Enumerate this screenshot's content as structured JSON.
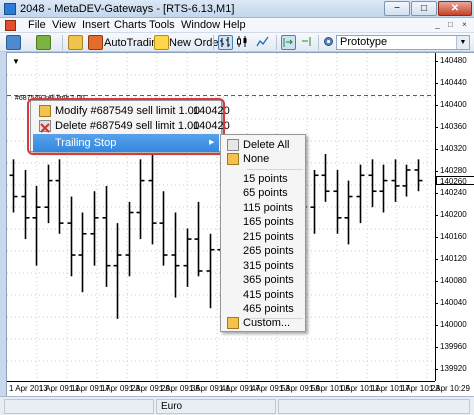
{
  "window": {
    "title": "2048 - MetaDEV-Gateways - [RTS-6.13,M1]",
    "min_glyph": "−",
    "max_glyph": "□",
    "close_glyph": "✕"
  },
  "menu": {
    "items": [
      "File",
      "View",
      "Insert",
      "Charts",
      "Tools",
      "Window",
      "Help"
    ],
    "mdi_min": "_",
    "mdi_restore": "□",
    "mdi_close": "×"
  },
  "toolbar": {
    "autotrading_label": "AutoTrading",
    "new_order_label": "New Order",
    "profile_value": "Prototype",
    "combo_arrow": "▼"
  },
  "chart": {
    "order_label": "#687549 sell limit 1.00",
    "scroll_marker": "▼",
    "current_price_label": "140260",
    "price_labels": [
      "140480",
      "140440",
      "140400",
      "140360",
      "140320",
      "140280",
      "140240",
      "140200",
      "140160",
      "140120",
      "140080",
      "140040",
      "140000",
      "139960",
      "139920"
    ],
    "time_labels": [
      "1 Apr 2013",
      "1 Apr 09:11",
      "1 Apr 09:17",
      "1 Apr 09:23",
      "1 Apr 09:29",
      "1 Apr 09:35",
      "1 Apr 09:41",
      "1 Apr 09:47",
      "1 Apr 09:53",
      "1 Apr 09:59",
      "1 Apr 10:05",
      "1 Apr 10:11",
      "1 Apr 10:17",
      "1 Apr 10:23",
      "1 Apr 10:29"
    ],
    "colors": {
      "grid": "#c8c8c8",
      "bars": "#000000",
      "order_line": "#00a000"
    }
  },
  "chart_data": {
    "type": "ohlc",
    "title": "",
    "xlabel": "",
    "ylabel": "",
    "ylim": [
      139900,
      140500
    ],
    "bars": [
      {
        "o": 140270,
        "h": 140300,
        "l": 140200,
        "c": 140230
      },
      {
        "o": 140230,
        "h": 140280,
        "l": 140150,
        "c": 140190
      },
      {
        "o": 140190,
        "h": 140250,
        "l": 140100,
        "c": 140210
      },
      {
        "o": 140210,
        "h": 140290,
        "l": 140180,
        "c": 140260
      },
      {
        "o": 140260,
        "h": 140300,
        "l": 140160,
        "c": 140180
      },
      {
        "o": 140180,
        "h": 140230,
        "l": 140080,
        "c": 140120
      },
      {
        "o": 140120,
        "h": 140200,
        "l": 140050,
        "c": 140160
      },
      {
        "o": 140160,
        "h": 140240,
        "l": 140100,
        "c": 140190
      },
      {
        "o": 140190,
        "h": 140250,
        "l": 140060,
        "c": 140100
      },
      {
        "o": 140100,
        "h": 140180,
        "l": 140000,
        "c": 140120
      },
      {
        "o": 140120,
        "h": 140220,
        "l": 140080,
        "c": 140200
      },
      {
        "o": 140200,
        "h": 140300,
        "l": 140150,
        "c": 140260
      },
      {
        "o": 140260,
        "h": 140310,
        "l": 140140,
        "c": 140180
      },
      {
        "o": 140180,
        "h": 140240,
        "l": 140100,
        "c": 140120
      },
      {
        "o": 140120,
        "h": 140200,
        "l": 140040,
        "c": 140100
      },
      {
        "o": 140100,
        "h": 140170,
        "l": 140060,
        "c": 140150
      },
      {
        "o": 140150,
        "h": 140220,
        "l": 140080,
        "c": 140090
      },
      {
        "o": 140090,
        "h": 140160,
        "l": 140020,
        "c": 140130
      },
      {
        "o": 140130,
        "h": 140200,
        "l": 140080,
        "c": 140110
      },
      {
        "o": 140110,
        "h": 140190,
        "l": 140070,
        "c": 140170
      },
      {
        "o": 140170,
        "h": 140240,
        "l": 140120,
        "c": 140200
      },
      {
        "o": 140200,
        "h": 140260,
        "l": 140120,
        "c": 140150
      },
      {
        "o": 140150,
        "h": 140220,
        "l": 140100,
        "c": 140180
      },
      {
        "o": 140180,
        "h": 140260,
        "l": 140140,
        "c": 140230
      },
      {
        "o": 140230,
        "h": 140290,
        "l": 140170,
        "c": 140250
      },
      {
        "o": 140250,
        "h": 140300,
        "l": 140190,
        "c": 140210
      },
      {
        "o": 140210,
        "h": 140280,
        "l": 140160,
        "c": 140270
      },
      {
        "o": 140270,
        "h": 140310,
        "l": 140220,
        "c": 140240
      },
      {
        "o": 140240,
        "h": 140280,
        "l": 140160,
        "c": 140190
      },
      {
        "o": 140190,
        "h": 140260,
        "l": 140140,
        "c": 140230
      },
      {
        "o": 140230,
        "h": 140290,
        "l": 140180,
        "c": 140270
      },
      {
        "o": 140270,
        "h": 140300,
        "l": 140210,
        "c": 140240
      },
      {
        "o": 140240,
        "h": 140290,
        "l": 140200,
        "c": 140260
      },
      {
        "o": 140260,
        "h": 140300,
        "l": 140220,
        "c": 140250
      },
      {
        "o": 140250,
        "h": 140290,
        "l": 140230,
        "c": 140280
      },
      {
        "o": 140280,
        "h": 140300,
        "l": 140240,
        "c": 140260
      }
    ],
    "order_line_price": 140420
  },
  "context_menu": {
    "items": [
      {
        "label": "Modify #687549 sell limit 1.00",
        "value": "140420"
      },
      {
        "label": "Delete #687549 sell limit 1.00",
        "value": "140420"
      },
      {
        "label": "Trailing Stop",
        "submenu_arrow": "▶"
      }
    ]
  },
  "trailing_submenu": {
    "items": [
      "Delete All",
      "None",
      "15 points",
      "65 points",
      "115 points",
      "165 points",
      "215 points",
      "265 points",
      "315 points",
      "365 points",
      "415 points",
      "465 points",
      "Custom..."
    ]
  },
  "status": {
    "profile": "Euro"
  }
}
